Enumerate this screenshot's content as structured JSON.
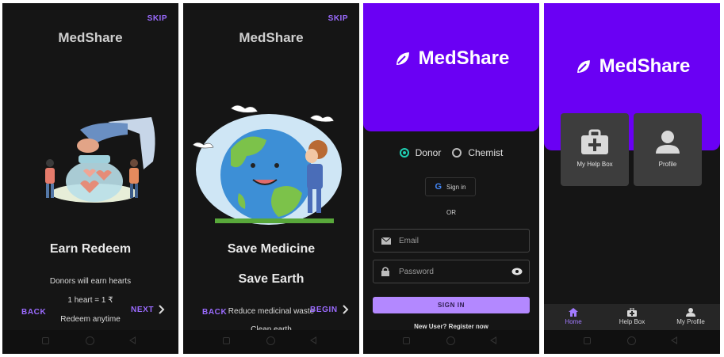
{
  "screens": {
    "onboarding1": {
      "skip": "SKIP",
      "app_title": "MedShare",
      "heading": "Earn Redeem",
      "lines": [
        "Donors will earn hearts",
        "1 heart = 1 ₹",
        "Redeem anytime"
      ],
      "back": "BACK",
      "next": "NEXT"
    },
    "onboarding2": {
      "skip": "SKIP",
      "app_title": "MedShare",
      "heading1": "Save Medicine",
      "heading2": "Save Earth",
      "lines": [
        "Reduce medicinal waste",
        "Clean earth"
      ],
      "back": "BACK",
      "next": "BEGIN"
    },
    "login": {
      "brand": "MedShare",
      "radio_donor": "Donor",
      "radio_chemist": "Chemist",
      "google": "Sign in",
      "or": "OR",
      "email_placeholder": "Email",
      "password_placeholder": "Password",
      "sign_in": "SIGN IN",
      "register": "New User? Register now"
    },
    "home": {
      "brand": "MedShare",
      "tile_helpbox": "My Help Box",
      "tile_profile": "Profile",
      "nav": [
        "Home",
        "Help Box",
        "My Profile"
      ]
    }
  },
  "colors": {
    "accent": "#6a00f4",
    "accent_light": "#b388ff",
    "radio_on": "#1fd1b4",
    "background": "#151515"
  }
}
